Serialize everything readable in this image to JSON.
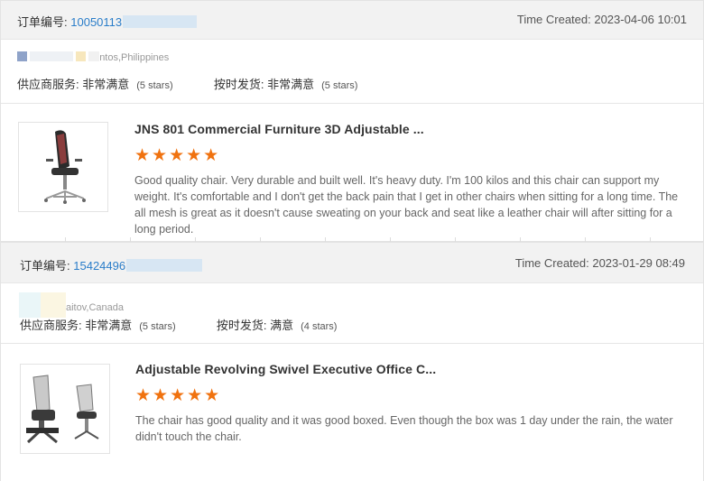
{
  "orders": [
    {
      "order_label": "订单编号:",
      "order_no": "10050113",
      "time_created": "Time Created: 2023-04-06 10:01",
      "location": "ntos,Philippines",
      "supplier_label": "供应商服务:",
      "supplier_value": "非常满意",
      "supplier_stars": "(5 stars)",
      "ontime_label": "按时发货:",
      "ontime_value": "非常满意",
      "ontime_stars": "(5 stars)",
      "product_name": "JNS 801 Commercial Furniture 3D Adjustable ...",
      "stars": "★★★★★",
      "review": "Good quality chair. Very durable and built well. It's heavy duty. I'm 100 kilos and this chair can support my weight. It's comfortable and I don't get the back pain that I get in other chairs when sitting for a long time. The all mesh is great as it doesn't cause sweating on your back and seat like a leather chair will after sitting for a long period."
    },
    {
      "order_label": "订单编号:",
      "order_no": "15424496",
      "time_created": "Time Created: 2023-01-29 08:49",
      "location": "aitov,Canada",
      "supplier_label": "供应商服务:",
      "supplier_value": "非常满意",
      "supplier_stars": "(5 stars)",
      "ontime_label": "按时发货:",
      "ontime_value": "满意",
      "ontime_stars": "(4 stars)",
      "product_name": "Adjustable Revolving Swivel Executive Office C...",
      "stars": "★★★★★",
      "review": "The chair has good quality and it was good boxed. Even though the box was 1 day under the rain, the water didn't touch the chair."
    }
  ],
  "colors": {
    "accent": "#2a7dc9",
    "star": "#f0720f"
  },
  "icons": [
    "office-chair-image",
    "office-chair-set-image"
  ]
}
